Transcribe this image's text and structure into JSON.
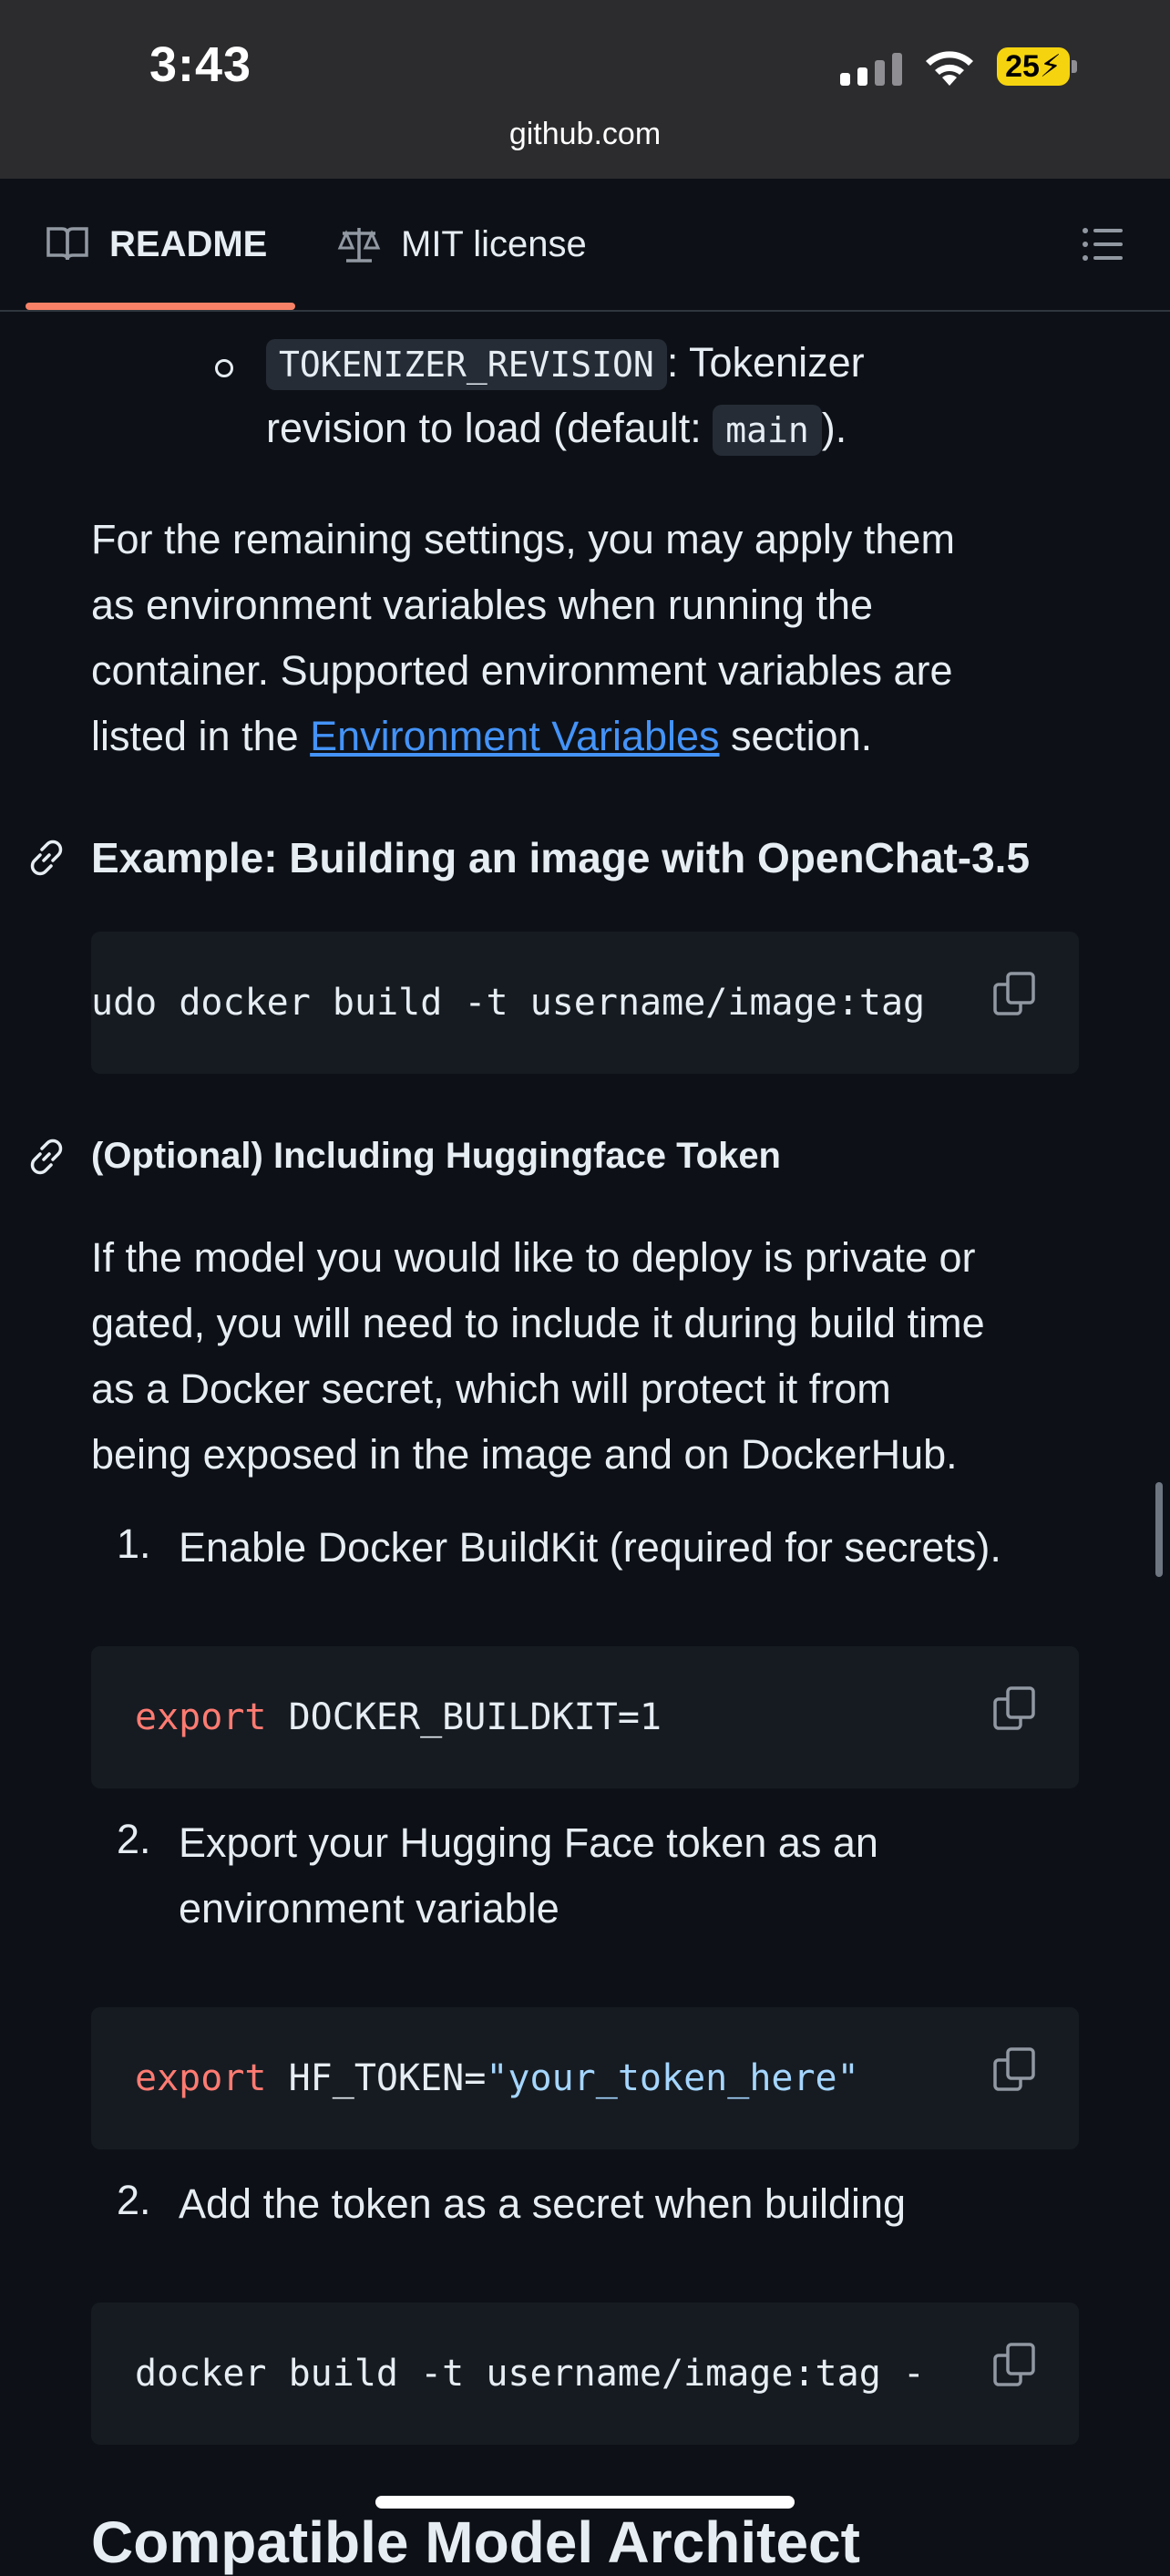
{
  "status_bar": {
    "time": "3:43",
    "battery": "25"
  },
  "browser": {
    "url": "github.com"
  },
  "tabs": {
    "readme": "README",
    "license": "MIT license"
  },
  "content": {
    "tokenizer_item": {
      "code": "TOKENIZER_REVISION",
      "text1": ": Tokenizer",
      "text2": "revision to load (default: ",
      "default_code": "main",
      "text3": ")."
    },
    "remaining": {
      "line1": "For the remaining settings, you may apply them",
      "line2": "as environment variables when running the",
      "line3": "container. Supported environment variables are",
      "line4_pre": "listed in the ",
      "link": "Environment Variables",
      "line4_post": " section."
    },
    "heading_example": "Example: Building an image with OpenChat-3.5",
    "code_example": "udo docker build -t username/image:tag",
    "heading_optional": "(Optional) Including Huggingface Token",
    "optional_para": {
      "line1": "If the model you would like to deploy is private or",
      "line2": "gated, you will need to include it during build time",
      "line3": "as a Docker secret, which will protect it from",
      "line4": "being exposed in the image and on DockerHub."
    },
    "steps": [
      {
        "num": "1.",
        "text": "Enable Docker BuildKit (required for secrets).",
        "kw": "export",
        "rest": " DOCKER_BUILDKIT=1"
      },
      {
        "num": "2.",
        "text1": "Export your Hugging Face token as an",
        "text2": "environment variable",
        "kw": "export",
        "rest": " HF_TOKEN=",
        "str": "\"your_token_here\""
      },
      {
        "num": "2.",
        "text": "Add the token as a secret when building",
        "code": "docker build -t username/image:tag -"
      }
    ],
    "next_heading": "Compatible Model Architect"
  }
}
